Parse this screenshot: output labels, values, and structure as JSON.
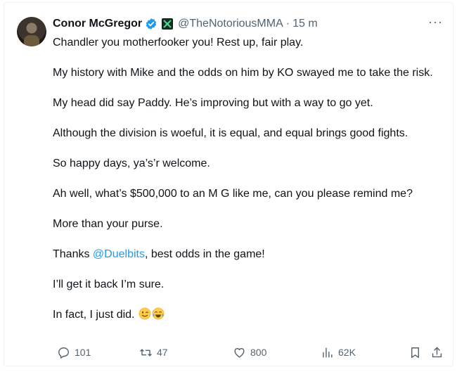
{
  "tweet": {
    "author": {
      "name": "Conor McGregor",
      "handle": "@TheNotoriousMMA",
      "separator": "·",
      "time": "15 m",
      "verified_color": "#1d9bf0"
    },
    "paragraphs": [
      "Chandler you motherfooker you! Rest up, fair play.",
      "My history with Mike and the odds on him by KO swayed me to take the risk.",
      "My head did say Paddy. He’s improving but with a way to go yet.",
      "Although the division is woeful, it is equal, and equal brings good fights.",
      "So happy days, ya’s’r welcome.",
      "Ah well, what’s $500,000 to an M G like me, can you please remind me?",
      "More than your purse."
    ],
    "thanks": {
      "prefix": "Thanks ",
      "mention": "@Duelbits",
      "suffix": ", best odds in the game!"
    },
    "closing": [
      "I’ll get it back I’m sure.",
      "In fact, I just did."
    ],
    "emojis": [
      "winking-face-icon",
      "tears-of-joy-face-icon"
    ]
  },
  "actions": {
    "replies": "101",
    "reposts": "47",
    "likes": "800",
    "views": "62K"
  },
  "colors": {
    "text": "#0f1419",
    "secondary": "#536471",
    "link": "#1d9bf0"
  }
}
